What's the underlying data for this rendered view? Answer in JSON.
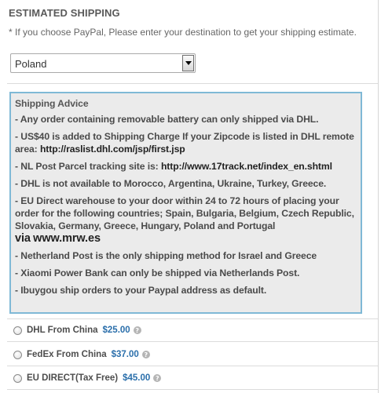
{
  "shipping": {
    "heading": "ESTIMATED SHIPPING",
    "note": "* If you choose PayPal, Please enter your destination to get your shipping estimate.",
    "country_select": {
      "selected": "Poland"
    }
  },
  "advice": {
    "title": "Shipping Advice",
    "items": [
      "- Any order containing removable battery can only shipped via DHL.",
      "- US$40 is added to Shipping Charge If your Zipcode is listed in DHL remote area:",
      "- NL Post Parcel tracking site is:",
      "- DHL is not available to Morocco, Argentina, Ukraine, Turkey, Greece.",
      "- EU Direct warehouse to your door within 24 to 72 hours of placing your order for the following countries; Spain, Bulgaria, Belgium, Czech Republic, Slovakia, Germany, Greece, Hungary, Poland and Portugal",
      "- Netherland Post is the only shipping method for Israel and Greece",
      "- Xiaomi Power Bank can only be shipped via Netherlands Post.",
      "- Ibuygou ship orders to your Paypal address as default."
    ],
    "links": {
      "dhl_remote": "http://raslist.dhl.com/jsp/first.jsp",
      "nl_tracking": "http://www.17track.net/index_en.shtml",
      "mrw_prefix": "via",
      "mrw": "www.mrw.es"
    }
  },
  "methods": [
    {
      "label": "DHL From China",
      "price": "$25.00"
    },
    {
      "label": "FedEx From China",
      "price": "$37.00"
    },
    {
      "label": "EU DIRECT(Tax Free)",
      "price": "$45.00"
    }
  ],
  "icons": {
    "select_arrow": "chevron-down-icon",
    "help": "help-icon"
  },
  "colors": {
    "advice_border": "#7fb9d6",
    "advice_background": "#ebebeb",
    "price": "#2b6fab"
  }
}
